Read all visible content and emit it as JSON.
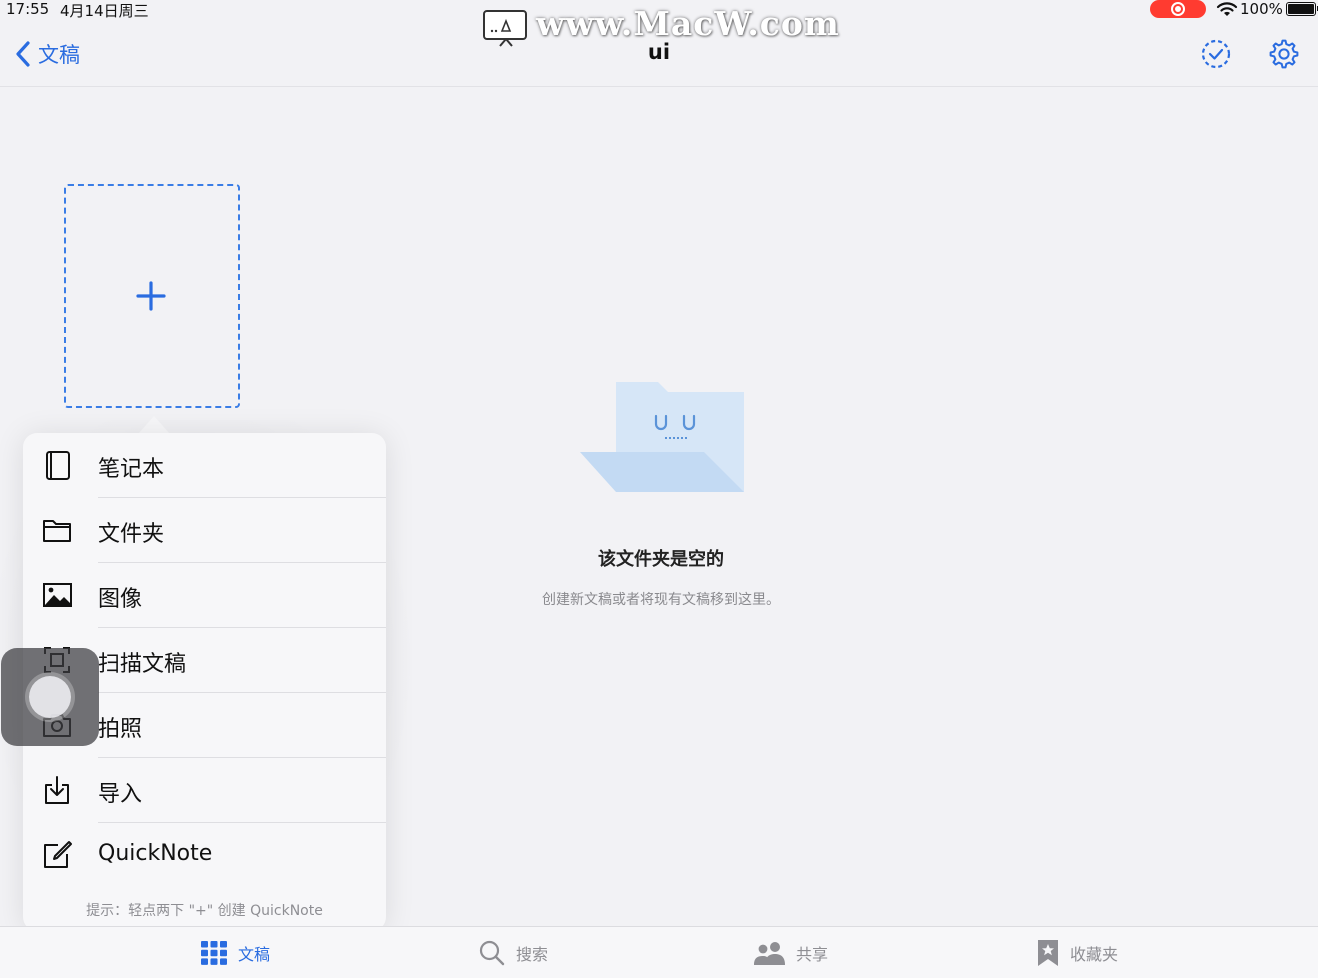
{
  "status_bar": {
    "time": "17:55",
    "date": "4月14日周三",
    "battery": "100%"
  },
  "watermark": {
    "text": "www.MacW.com"
  },
  "nav": {
    "back_label": "文稿",
    "title": "ui",
    "icons": [
      "chevron-left-icon",
      "select-check-icon",
      "gear-icon"
    ]
  },
  "empty_state": {
    "title": "该文件夹是空的",
    "subtitle": "创建新文稿或者将现有文稿移到这里。"
  },
  "popover": {
    "items": [
      {
        "label": "笔记本",
        "icon": "notebook-icon"
      },
      {
        "label": "文件夹",
        "icon": "folder-icon"
      },
      {
        "label": "图像",
        "icon": "image-icon"
      },
      {
        "label": "扫描文稿",
        "icon": "scan-icon"
      },
      {
        "label": "拍照",
        "icon": "camera-icon"
      },
      {
        "label": "导入",
        "icon": "import-icon"
      },
      {
        "label": "QuickNote",
        "icon": "quicknote-icon"
      }
    ],
    "hint": "提示：轻点两下 \"+\" 创建 QuickNote"
  },
  "tab_bar": {
    "tabs": [
      {
        "label": "文稿",
        "icon": "grid-icon",
        "active": true
      },
      {
        "label": "搜索",
        "icon": "search-icon",
        "active": false
      },
      {
        "label": "共享",
        "icon": "people-icon",
        "active": false
      },
      {
        "label": "收藏夹",
        "icon": "bookmark-star-icon",
        "active": false
      }
    ]
  },
  "colors": {
    "accent": "#2a6ce0",
    "background": "#f2f2f5",
    "recording": "#ff3b30"
  }
}
